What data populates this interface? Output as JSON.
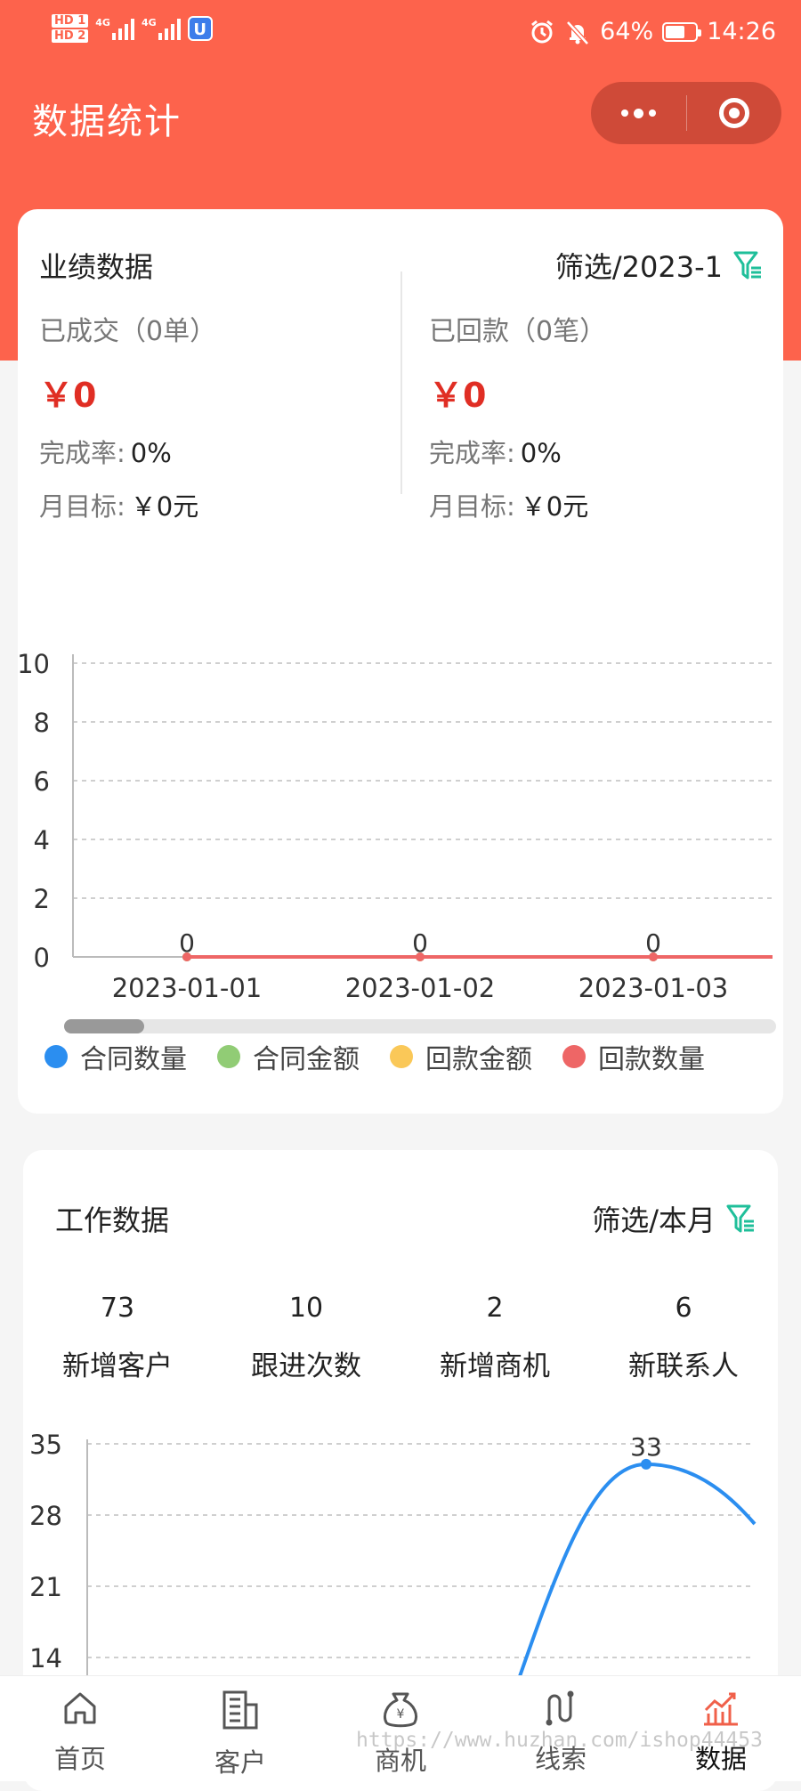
{
  "status_bar": {
    "network_badges": [
      "HD 1",
      "HD 2"
    ],
    "signal_labels": [
      "4G",
      "4G"
    ],
    "battery": "64%",
    "battery_level": 0.64,
    "time": "14:26"
  },
  "header": {
    "title": "数据统计"
  },
  "performance": {
    "title": "业绩数据",
    "filter_label": "筛选/2023-1",
    "deals": {
      "label": "已成交（0单）",
      "amount": "￥0",
      "rate_label": "完成率:",
      "rate_value": "0%",
      "target_label": "月目标:",
      "target_value": "￥0元"
    },
    "payments": {
      "label": "已回款（0笔）",
      "amount": "￥0",
      "rate_label": "完成率:",
      "rate_value": "0%",
      "target_label": "月目标:",
      "target_value": "￥0元"
    },
    "legend": [
      {
        "label": "合同数量",
        "color": "#2b8ef0"
      },
      {
        "label": "合同金额",
        "color": "#91cc75"
      },
      {
        "label": "回款金额",
        "color": "#fac858"
      },
      {
        "label": "回款数量",
        "color": "#ee6666"
      }
    ]
  },
  "work": {
    "title": "工作数据",
    "filter_label": "筛选/本月",
    "stats": [
      {
        "value": "73",
        "label": "新增客户"
      },
      {
        "value": "10",
        "label": "跟进次数"
      },
      {
        "value": "2",
        "label": "新增商机"
      },
      {
        "value": "6",
        "label": "新联系人"
      }
    ]
  },
  "chart_data": [
    {
      "type": "line",
      "categories": [
        "2023-01-01",
        "2023-01-02",
        "2023-01-03"
      ],
      "ylim": [
        0,
        10
      ],
      "yticks": [
        "0",
        "2",
        "4",
        "6",
        "8",
        "10"
      ],
      "grid": true,
      "legend_position": "bottom",
      "series": [
        {
          "name": "合同数量",
          "color": "#2b8ef0",
          "values": [
            0,
            0,
            0
          ]
        },
        {
          "name": "合同金额",
          "color": "#91cc75",
          "values": [
            0,
            0,
            0
          ]
        },
        {
          "name": "回款金额",
          "color": "#fac858",
          "values": [
            0,
            0,
            0
          ]
        },
        {
          "name": "回款数量",
          "color": "#ee6666",
          "values": [
            0,
            0,
            0
          ]
        }
      ],
      "data_labels": [
        "0",
        "0",
        "0"
      ],
      "scrollbar_position": 0.0
    },
    {
      "type": "line",
      "ylim": [
        0,
        35
      ],
      "yticks": [
        "14",
        "21",
        "28",
        "35"
      ],
      "grid": true,
      "series": [
        {
          "color": "#2b8ef0",
          "visible_peak": 33
        }
      ],
      "data_labels": [
        "33"
      ]
    }
  ],
  "tabbar": [
    {
      "label": "首页",
      "icon": "home-icon",
      "active": false
    },
    {
      "label": "客户",
      "icon": "building-icon",
      "active": false
    },
    {
      "label": "商机",
      "icon": "money-bag-icon",
      "active": false
    },
    {
      "label": "线索",
      "icon": "route-icon",
      "active": false
    },
    {
      "label": "数据",
      "icon": "chart-icon",
      "active": true
    }
  ],
  "watermark": "https://www.huzhan.com/ishop44453"
}
